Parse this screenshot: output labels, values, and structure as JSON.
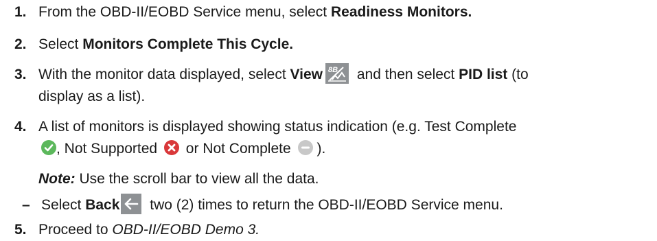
{
  "steps": [
    {
      "number": "1.",
      "text_before": "From the OBD-II/EOBD Service menu, select ",
      "bold": "Readiness Monitors."
    },
    {
      "number": "2.",
      "text_before": "Select ",
      "bold": "Monitors Complete This Cycle."
    },
    {
      "number": "3.",
      "text_before": "With the monitor data displayed, select ",
      "bold_view": "View",
      "text_middle": " and then select ",
      "bold_pid": "PID list",
      "text_after": " (to",
      "line2": "display as a list)."
    },
    {
      "number": "4.",
      "line1": "A list of monitors is displayed showing status indication (e.g. Test Complete",
      "complete_text": ", Not Supported ",
      "not_supported_text": " or Not Complete ",
      "end_text": ")."
    },
    {
      "number": "5.",
      "text_before": "Proceed to ",
      "italic": "OBD-II/EOBD Demo 3."
    }
  ],
  "note": {
    "label": "Note:",
    "text": " Use the scroll bar to view all the data."
  },
  "sub_step": {
    "dash": "–",
    "text_before": "Select ",
    "bold": "Back",
    "text_after": " two (2) times to return the OBD-II/EOBD Service menu."
  },
  "icons": {
    "view": "view-pid-icon",
    "back": "back-arrow-icon",
    "complete": "check-circle-icon",
    "not_supported": "x-circle-icon",
    "not_complete": "minus-circle-icon"
  },
  "colors": {
    "text": "#1a1a1a",
    "icon_bg": "#8e9194",
    "complete": "#5cb85c",
    "not_supported": "#d9383a",
    "not_complete": "#c8c8c8"
  }
}
